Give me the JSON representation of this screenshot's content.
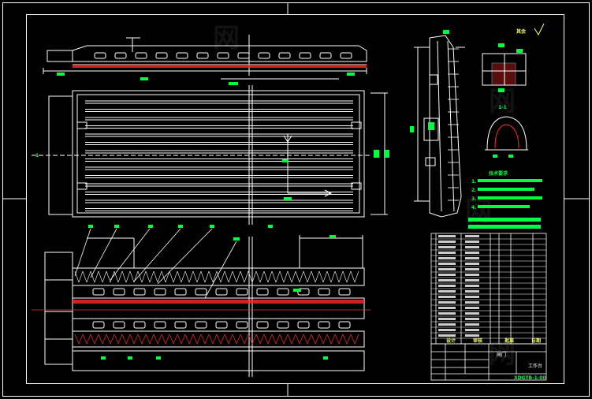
{
  "colors": {
    "background": "#000000",
    "line": "#ffffff",
    "dim": "#00ff3c",
    "hatch": "#ff2a2a",
    "tag": "#00ff3c"
  },
  "sheet": {
    "roughness_label": "其余",
    "section_label": "1-1",
    "section_marker_left": "1"
  },
  "notes": {
    "title": "技术要求",
    "lines": [
      "1.",
      "2.",
      "3.",
      "4."
    ]
  },
  "title_block": {
    "design": "设计",
    "review": "审核",
    "approve": "批准",
    "drawing_name": "闸门",
    "company": "工作台",
    "drawing_number": "XDGTB-1-00",
    "date": "日期"
  },
  "bom": {
    "rows": 20
  },
  "watermark": "网"
}
